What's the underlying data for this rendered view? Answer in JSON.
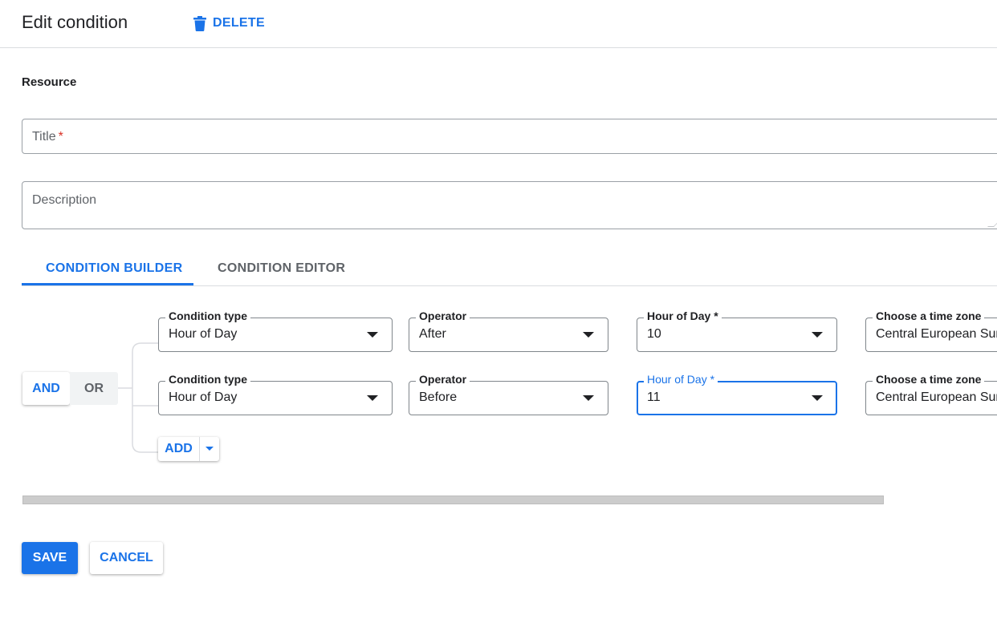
{
  "header": {
    "title": "Edit condition",
    "delete_label": "DELETE"
  },
  "resource": {
    "label": "Resource"
  },
  "fields": {
    "title": {
      "placeholder": "Title",
      "required_mark": "*"
    },
    "description": {
      "placeholder": "Description"
    }
  },
  "tabs": [
    {
      "label": "CONDITION BUILDER",
      "active": true
    },
    {
      "label": "CONDITION EDITOR",
      "active": false
    }
  ],
  "logic": {
    "and_label": "AND",
    "or_label": "OR",
    "selected": "AND"
  },
  "conditions": [
    {
      "type_label": "Condition type",
      "type_value": "Hour of Day",
      "operator_label": "Operator",
      "operator_value": "After",
      "hour_label": "Hour of Day *",
      "hour_value": "10",
      "tz_label": "Choose a time zone",
      "tz_value": "Central European Summer Time"
    },
    {
      "type_label": "Condition type",
      "type_value": "Hour of Day",
      "operator_label": "Operator",
      "operator_value": "Before",
      "hour_label": "Hour of Day *",
      "hour_value": "11",
      "tz_label": "Choose a time zone",
      "tz_value": "Central European Summer Time"
    }
  ],
  "add": {
    "label": "ADD"
  },
  "footer": {
    "save_label": "SAVE",
    "cancel_label": "CANCEL"
  },
  "colors": {
    "accent": "#1a73e8",
    "required": "#d93025",
    "text": "#202124",
    "muted": "#5f6368",
    "border": "#80868b"
  },
  "icons": {
    "delete": "trash-icon",
    "dropdown": "caret-down-icon",
    "add_menu": "caret-down-icon"
  }
}
